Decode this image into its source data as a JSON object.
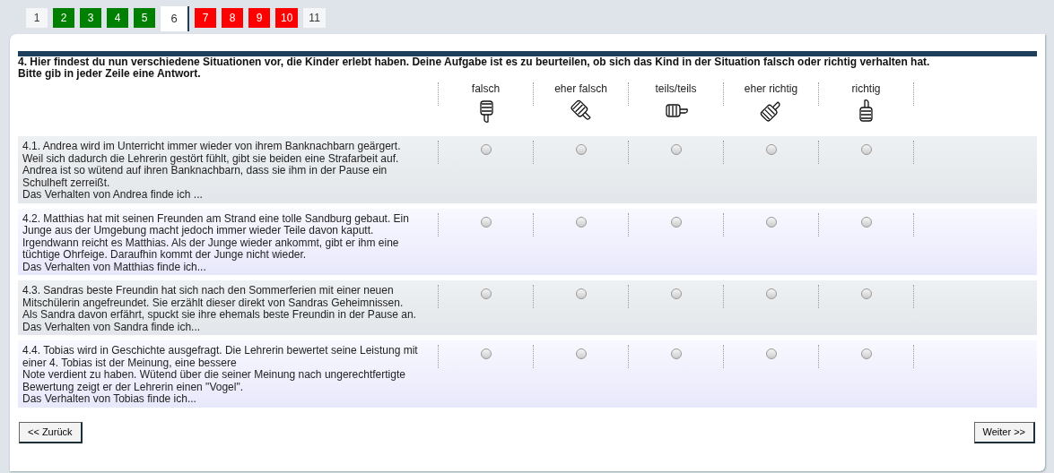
{
  "pages": [
    {
      "label": "1",
      "color": "#f4f6f8",
      "selected": false
    },
    {
      "label": "2",
      "color": "#008000",
      "selected": false
    },
    {
      "label": "3",
      "color": "#008000",
      "selected": false
    },
    {
      "label": "4",
      "color": "#008000",
      "selected": false
    },
    {
      "label": "5",
      "color": "#008000",
      "selected": false
    },
    {
      "label": "6",
      "color": "#ffffff",
      "selected": true
    },
    {
      "label": "7",
      "color": "#ff0000",
      "selected": false
    },
    {
      "label": "8",
      "color": "#ff0000",
      "selected": false
    },
    {
      "label": "9",
      "color": "#ff0000",
      "selected": false
    },
    {
      "label": "10",
      "color": "#ff0000",
      "selected": false
    },
    {
      "label": "11",
      "color": "#f4f6f8",
      "selected": false
    }
  ],
  "question": {
    "title": "4. Hier findest du nun verschiedene Situationen vor, die Kinder erlebt haben. Deine Aufgabe ist es zu beurteilen, ob sich das Kind in der Situation falsch oder richtig verhalten hat.\nBitte gib in jeder Zeile eine Antwort.",
    "scale": [
      "falsch",
      "eher falsch",
      "teils/teils",
      "eher richtig",
      "richtig"
    ],
    "items": [
      {
        "text": "4.1. Andrea wird im Unterricht immer wieder von ihrem Banknachbarn geärgert.\nWeil sich dadurch die Lehrerin gestört fühlt, gibt sie beiden eine Strafarbeit auf.\nAndrea ist so wütend auf ihren Banknachbarn, dass sie ihm in der Pause ein\nSchulheft zerreißt.\nDas Verhalten von Andrea finde ich ...",
        "answers": [
          false,
          false,
          false,
          false,
          false
        ]
      },
      {
        "text": "4.2. Matthias hat mit seinen Freunden am Strand eine tolle Sandburg gebaut. Ein\nJunge aus der Umgebung macht jedoch immer wieder Teile davon kaputt.\nIrgendwann reicht es Matthias. Als der Junge wieder ankommt, gibt er ihm eine\ntüchtige Ohrfeige. Daraufhin kommt der Junge nicht wieder.\nDas Verhalten von Matthias finde ich...",
        "answers": [
          false,
          false,
          false,
          false,
          false
        ]
      },
      {
        "text": "4.3. Sandras beste Freundin hat sich nach den Sommerferien mit einer neuen\nMitschülerin angefreundet. Sie erzählt dieser direkt von Sandras Geheimnissen.\nAls Sandra davon erfährt, spuckt sie ihre ehemals beste Freundin in der Pause an.\nDas Verhalten von Sandra finde ich...",
        "answers": [
          false,
          false,
          false,
          false,
          false
        ]
      },
      {
        "text": "4.4. Tobias wird in Geschichte ausgefragt. Die Lehrerin bewertet seine Leistung mit\neiner 4. Tobias ist der Meinung, eine bessere\nNote verdient zu haben. Wütend über die seiner Meinung nach ungerechtfertigte\nBewertung zeigt er der Lehrerin einen \"Vogel\".\nDas Verhalten von Tobias finde ich...",
        "answers": [
          false,
          false,
          false,
          false,
          false
        ]
      }
    ]
  },
  "buttons": {
    "back": "<< Zurück",
    "next": "Weiter >>"
  }
}
